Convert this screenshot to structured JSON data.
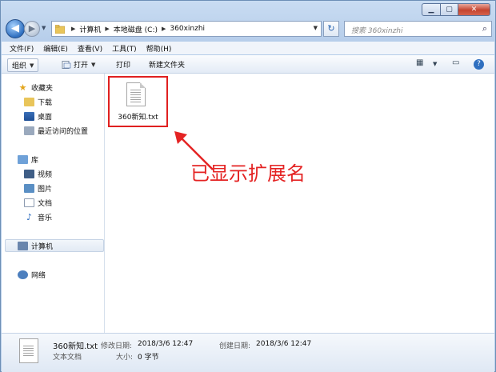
{
  "address": {
    "crumbs": [
      "计算机",
      "本地磁盘 (C:)",
      "360xinzhi"
    ],
    "search_placeholder": "搜索 360xinzhi"
  },
  "menu": [
    "文件(F)",
    "编辑(E)",
    "查看(V)",
    "工具(T)",
    "帮助(H)"
  ],
  "toolbar": {
    "organize": "组织",
    "open": "打开",
    "print": "打印",
    "new_folder": "新建文件夹"
  },
  "nav": {
    "favorites": "收藏夹",
    "downloads": "下载",
    "desktop": "桌面",
    "recent": "最近访问的位置",
    "libraries": "库",
    "videos": "视频",
    "pictures": "图片",
    "documents": "文档",
    "music": "音乐",
    "computer": "计算机",
    "network": "网络"
  },
  "file": {
    "name": "360新知.txt"
  },
  "annotation": "已显示扩展名",
  "details": {
    "name": "360新知.txt",
    "type": "文本文档",
    "modified_label": "修改日期:",
    "modified_value": "2018/3/6 12:47",
    "size_label": "大小:",
    "size_value": "0 字节",
    "created_label": "创建日期:",
    "created_value": "2018/3/6 12:47"
  }
}
